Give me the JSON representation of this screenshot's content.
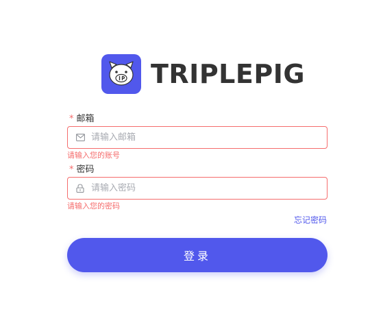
{
  "brand": {
    "name": "TRIPLEPIG",
    "logo_color": "#5158ec"
  },
  "email_field": {
    "required_mark": "*",
    "label": "邮箱",
    "placeholder": "请输入邮箱",
    "value": "",
    "icon": "mail-icon",
    "error": "请输入您的账号"
  },
  "password_field": {
    "required_mark": "*",
    "label": "密码",
    "placeholder": "请输入密码",
    "value": "",
    "icon": "lock-icon",
    "error": "请输入您的密码"
  },
  "forgot_password": "忘记密码",
  "login_button": "登录",
  "colors": {
    "primary": "#5158ec",
    "error": "#f56c6c",
    "text": "#333333",
    "placeholder": "#a8abb2"
  }
}
